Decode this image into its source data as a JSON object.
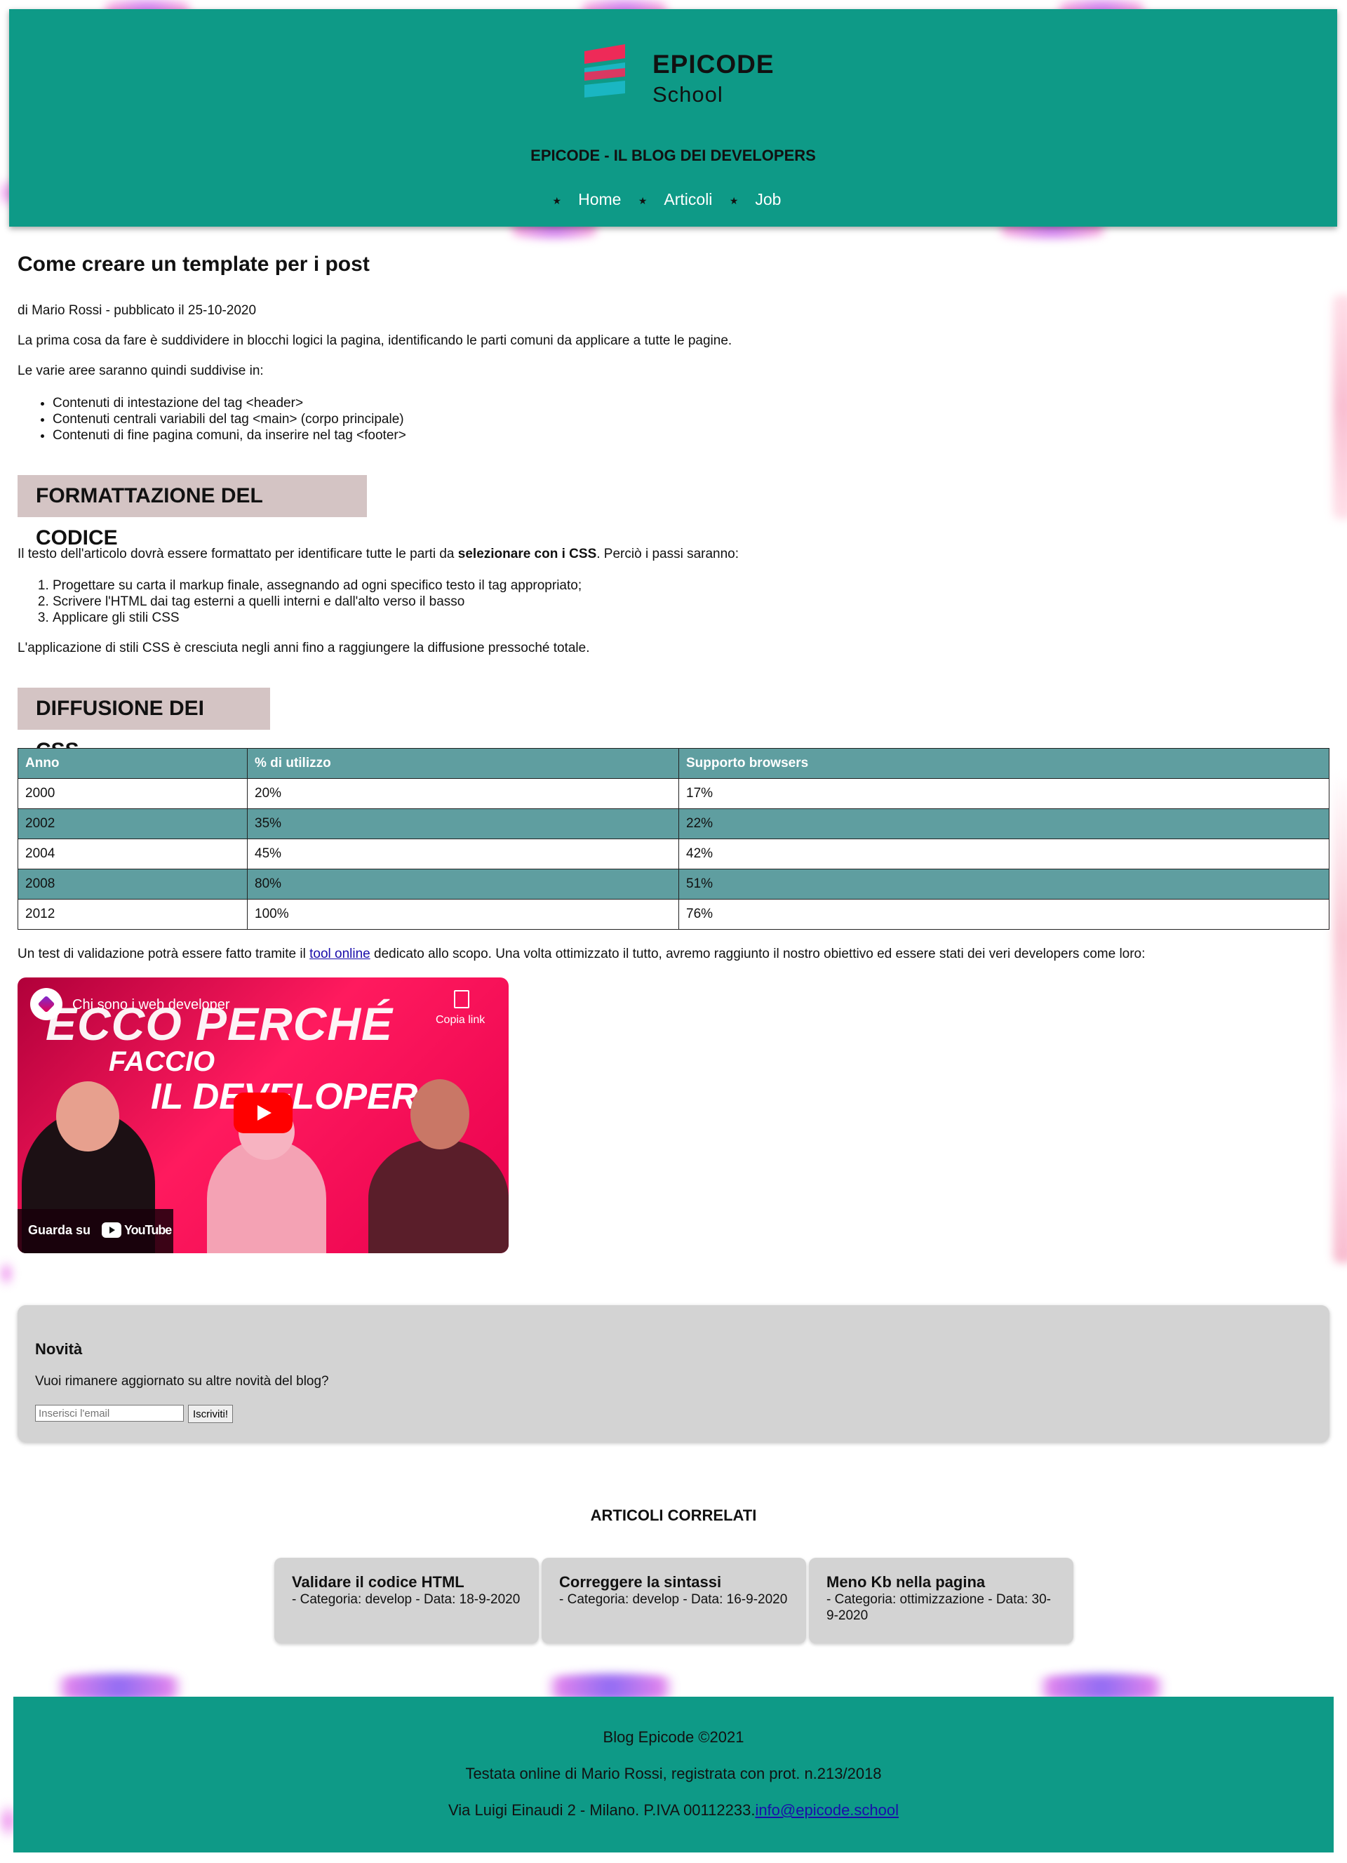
{
  "header": {
    "logo_line1": "EPICODE",
    "logo_line2": "School",
    "blog_title": "EPICODE - IL BLOG DEI DEVELOPERS",
    "nav": [
      "Home",
      "Articoli",
      "Job"
    ],
    "background_color": "#0e9a87"
  },
  "post": {
    "title": "Come creare un template per i post",
    "meta": "di Mario Rossi - pubblicato il 25-10-2020",
    "p1": "La prima cosa da fare è suddividere in blocchi logici la pagina, identificando le parti comuni da applicare a tutte le pagine.",
    "p2": "Le varie aree saranno quindi suddivise in:",
    "areas": [
      "Contenuti di intestazione del tag <header>",
      "Contenuti centrali variabili del tag <main> (corpo principale)",
      "Contenuti di fine pagina comuni, da inserire nel tag <footer>"
    ],
    "section1_title": "FORMATTAZIONE DEL CODICE",
    "p3_before": "Il testo dell'articolo dovrà essere formattato per identificare tutte le parti da ",
    "p3_bold": "selezionare con i CSS",
    "p3_after": ". Perciò i passi saranno:",
    "steps": [
      "Progettare su carta il markup finale, assegnando ad ogni specifico testo il tag appropriato;",
      "Scrivere l'HTML dai tag esterni a quelli interni e dall'alto verso il basso",
      "Applicare gli stili CSS"
    ],
    "p4": "L'applicazione di stili CSS è cresciuta negli anni fino a raggiungere la diffusione pressoché totale.",
    "section2_title": "DIFFUSIONE DEI CSS",
    "p5_before": "Un test di validazione potrà essere fatto tramite il ",
    "p5_link": "tool online",
    "p5_after": " dedicato allo scopo. Una volta ottimizzato il tutto, avremo raggiunto il nostro obiettivo ed essere stati dei veri developers come loro:"
  },
  "table": {
    "headers": [
      "Anno",
      "% di utilizzo",
      "Supporto browsers"
    ],
    "rows": [
      [
        "2000",
        "20%",
        "17%"
      ],
      [
        "2002",
        "35%",
        "22%"
      ],
      [
        "2004",
        "45%",
        "42%"
      ],
      [
        "2008",
        "80%",
        "51%"
      ],
      [
        "2012",
        "100%",
        "76%"
      ]
    ],
    "header_color": "#5f9ea0"
  },
  "video": {
    "title": "Chi sono i web developer",
    "copy_label": "Copia link",
    "thumb_line1": "ECCO PERCHÉ",
    "thumb_line2": "FACCIO",
    "thumb_line3": "IL DEVELOPER",
    "watch_label": "Guarda su",
    "youtube_label": "YouTube"
  },
  "newsletter": {
    "title": "Novità",
    "text": "Vuoi rimanere aggiornato su altre novità del blog?",
    "email_placeholder": "Inserisci l'email",
    "button": "Iscriviti!"
  },
  "related": {
    "title": "ARTICOLI CORRELATI",
    "cards": [
      {
        "title": "Validare il codice HTML",
        "meta": "- Categoria: develop - Data: 18-9-2020"
      },
      {
        "title": "Correggere la sintassi",
        "meta": "- Categoria: develop - Data: 16-9-2020"
      },
      {
        "title": "Meno Kb nella pagina",
        "meta": "- Categoria: ottimizzazione - Data: 30-9-2020"
      }
    ]
  },
  "footer": {
    "line1": "Blog Epicode ©2021",
    "line2": "Testata online di Mario Rossi, registrata con prot. n.213/2018",
    "line3_text": "Via Luigi Einaudi 2 - Milano. P.IVA 00112233.",
    "email": "info@epicode.school"
  }
}
